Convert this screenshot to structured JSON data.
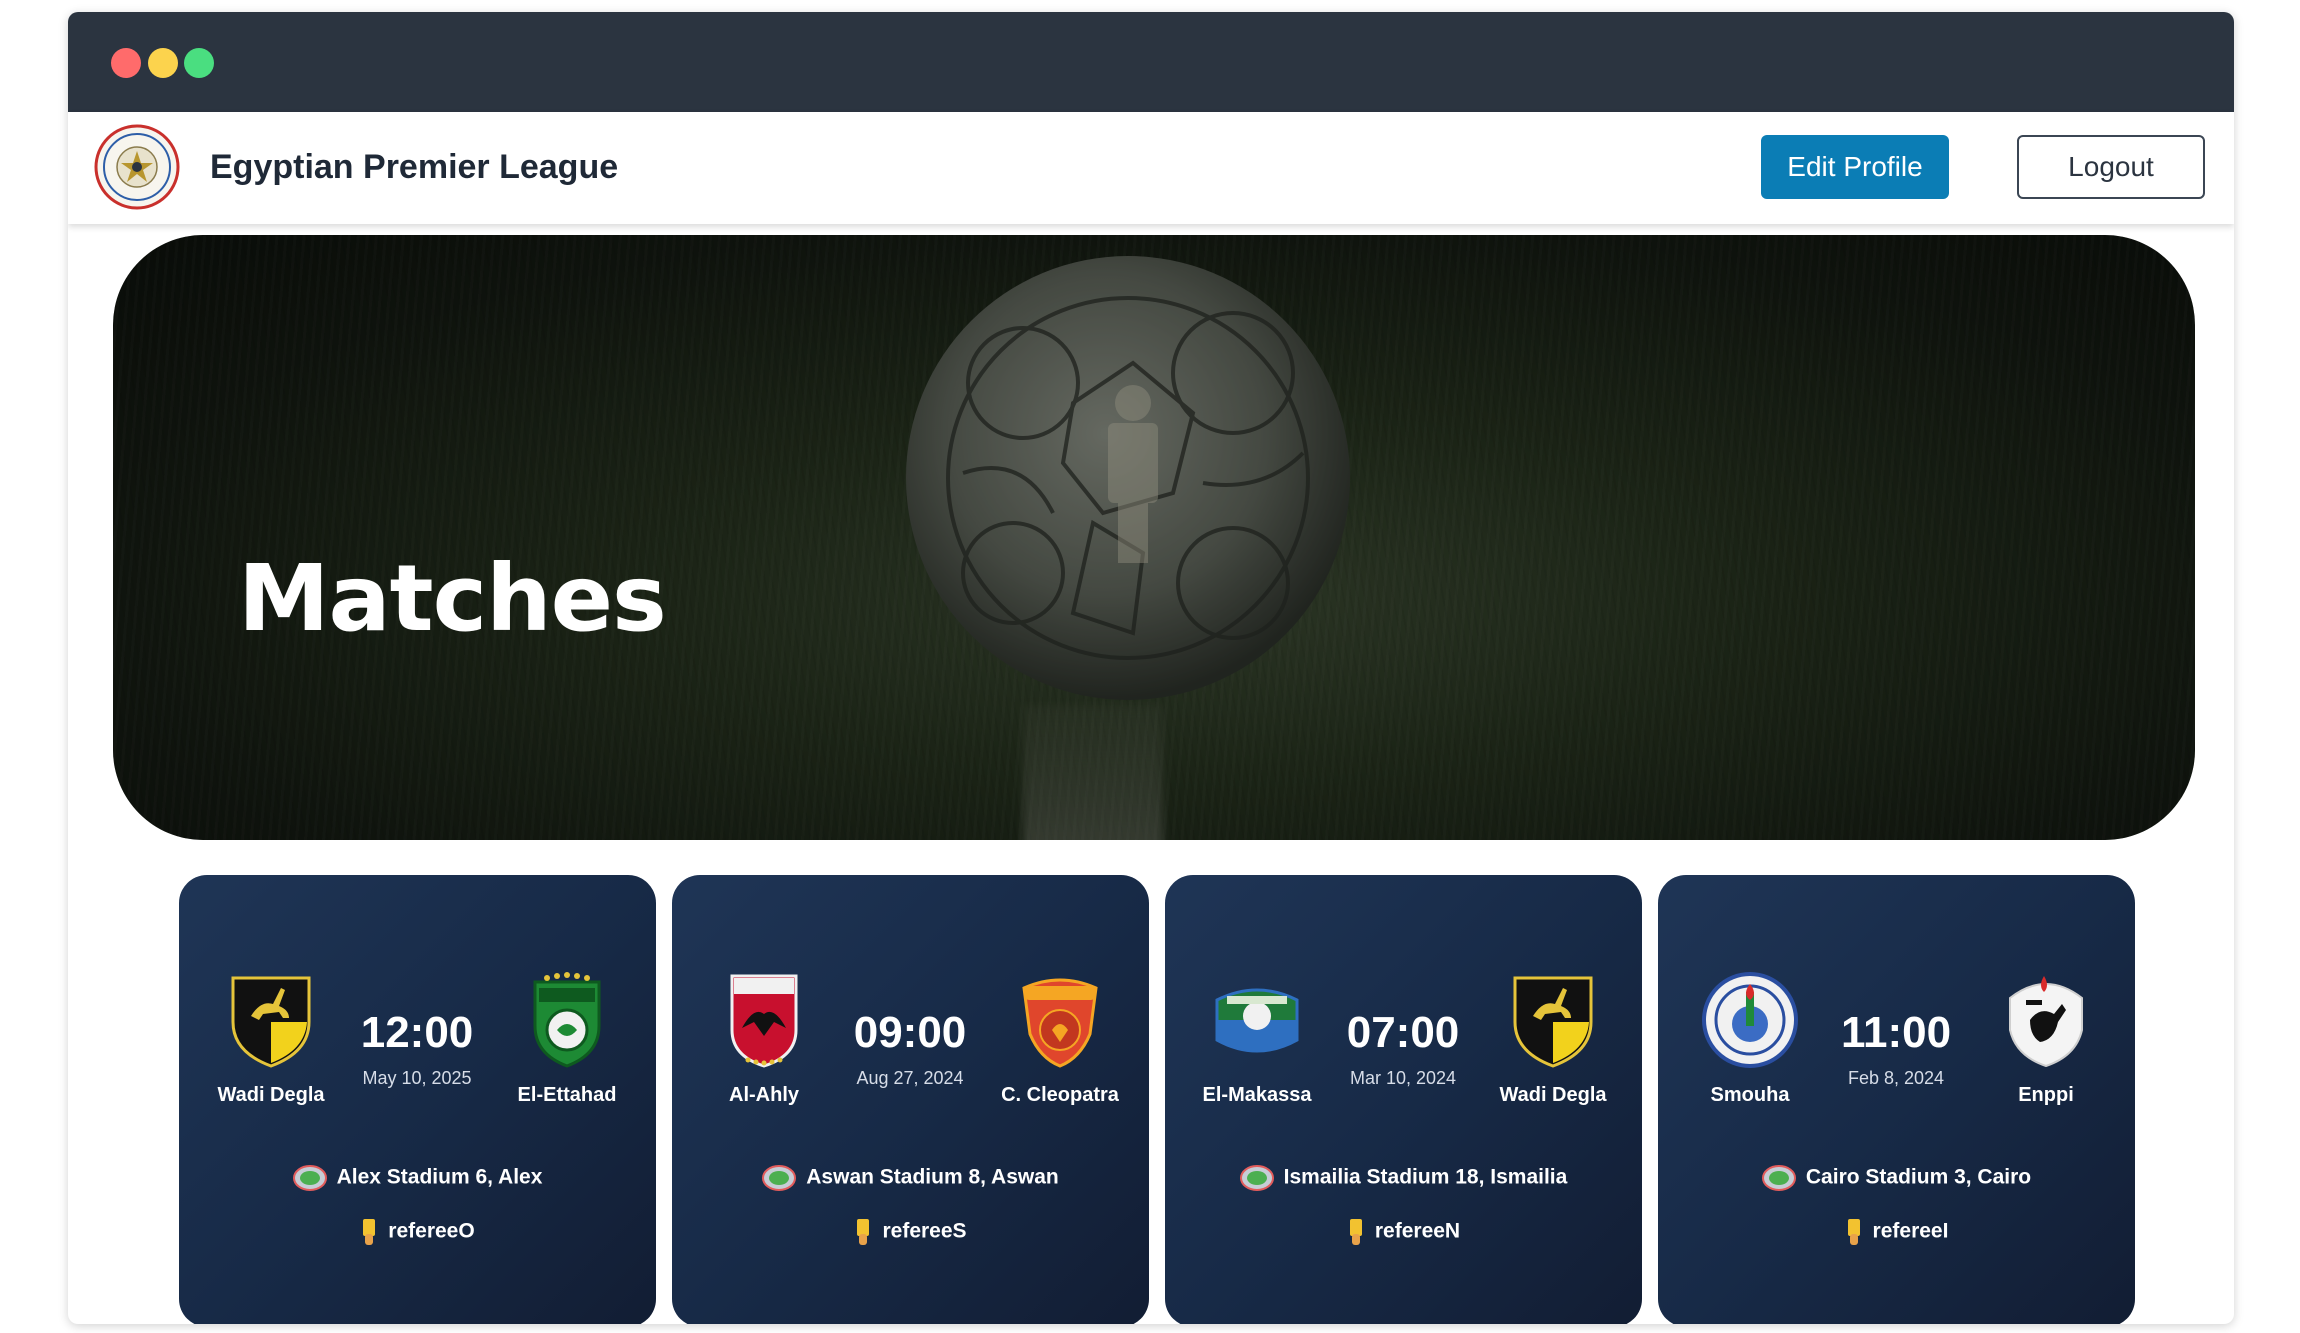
{
  "window": {
    "controls": [
      "close",
      "minimize",
      "maximize"
    ]
  },
  "navbar": {
    "brand": "Egyptian Premier League",
    "logo_icon": "league-logo-icon",
    "edit_profile_label": "Edit Profile",
    "logout_label": "Logout"
  },
  "hero": {
    "title": "Matches",
    "background": "football-on-grass"
  },
  "matches": [
    {
      "home": "Wadi Degla",
      "away": "El-Ettahad",
      "time": "12:00",
      "date": "May 10, 2025",
      "venue": "Alex Stadium 6, Alex",
      "referee": "refereeO"
    },
    {
      "home": "Al-Ahly",
      "away": "C. Cleopatra",
      "time": "09:00",
      "date": "Aug 27, 2024",
      "venue": "Aswan Stadium 8, Aswan",
      "referee": "refereeS"
    },
    {
      "home": "El-Makassa",
      "away": "Wadi Degla",
      "time": "07:00",
      "date": "Mar 10, 2024",
      "venue": "Ismailia Stadium 18, Ismailia",
      "referee": "refereeN"
    },
    {
      "home": "Smouha",
      "away": "Enppi",
      "time": "11:00",
      "date": "Feb 8, 2024",
      "venue": "Cairo Stadium 3, Cairo",
      "referee": "refereeI"
    }
  ],
  "colors": {
    "titlebar": "#2b3440",
    "primary_button": "#0b7db5",
    "card_bg": "#1f3556",
    "dot_red": "#ff6b6b",
    "dot_yellow": "#fcd34d",
    "dot_green": "#4ade80"
  }
}
